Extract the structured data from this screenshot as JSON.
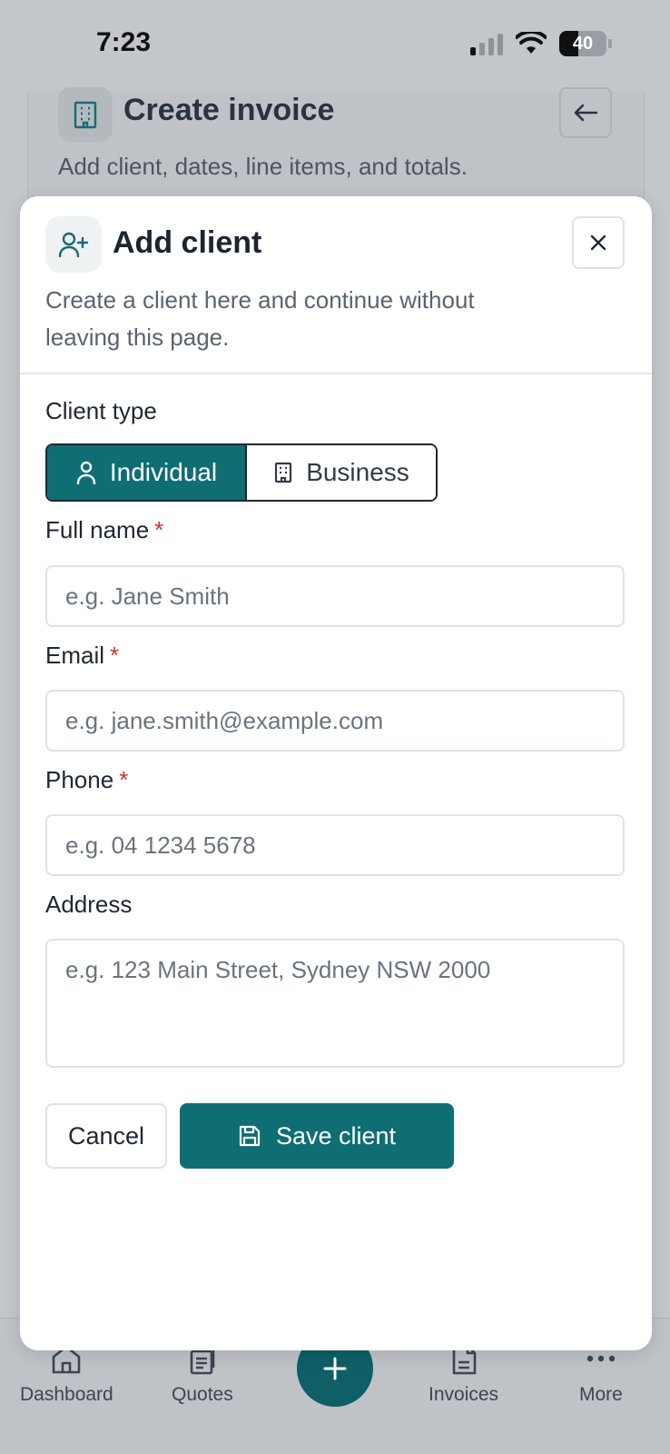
{
  "status_bar": {
    "time": "7:23",
    "battery": "40",
    "battery_level": 0.4
  },
  "background_page": {
    "title": "Create invoice",
    "subtitle": "Add client, dates, line items, and totals.",
    "icons": {
      "header": "building-icon",
      "back": "arrow-left-icon"
    }
  },
  "modal": {
    "title": "Add client",
    "description": "Create a client here and continue without leaving this page.",
    "icons": {
      "header": "user-plus-icon",
      "close": "close-icon"
    },
    "client_type": {
      "label": "Client type",
      "options": [
        {
          "label": "Individual",
          "icon": "user-icon",
          "selected": true
        },
        {
          "label": "Business",
          "icon": "building-icon",
          "selected": false
        }
      ]
    },
    "fields": {
      "full_name": {
        "label": "Full name",
        "required_mark": "*",
        "placeholder": "e.g. Jane Smith",
        "value": ""
      },
      "email": {
        "label": "Email",
        "required_mark": "*",
        "placeholder": "e.g. jane.smith@example.com",
        "value": ""
      },
      "phone": {
        "label": "Phone",
        "required_mark": "*",
        "placeholder": "e.g. 04 1234 5678",
        "value": ""
      },
      "address": {
        "label": "Address",
        "placeholder": "e.g. 123 Main Street, Sydney NSW 2000",
        "value": ""
      }
    },
    "actions": {
      "cancel": "Cancel",
      "save": "Save client",
      "save_icon": "floppy-disk-icon"
    }
  },
  "bottom_nav": {
    "items": [
      {
        "label": "Dashboard",
        "icon": "home-icon"
      },
      {
        "label": "Quotes",
        "icon": "quotes-icon"
      },
      {
        "label": "Invoices",
        "icon": "invoice-icon"
      },
      {
        "label": "More",
        "icon": "more-dots-icon"
      }
    ],
    "fab_icon": "plus-icon"
  },
  "colors": {
    "accent": "#0e6e74",
    "required": "#d0312d",
    "overlay": "#c3c6cb"
  }
}
